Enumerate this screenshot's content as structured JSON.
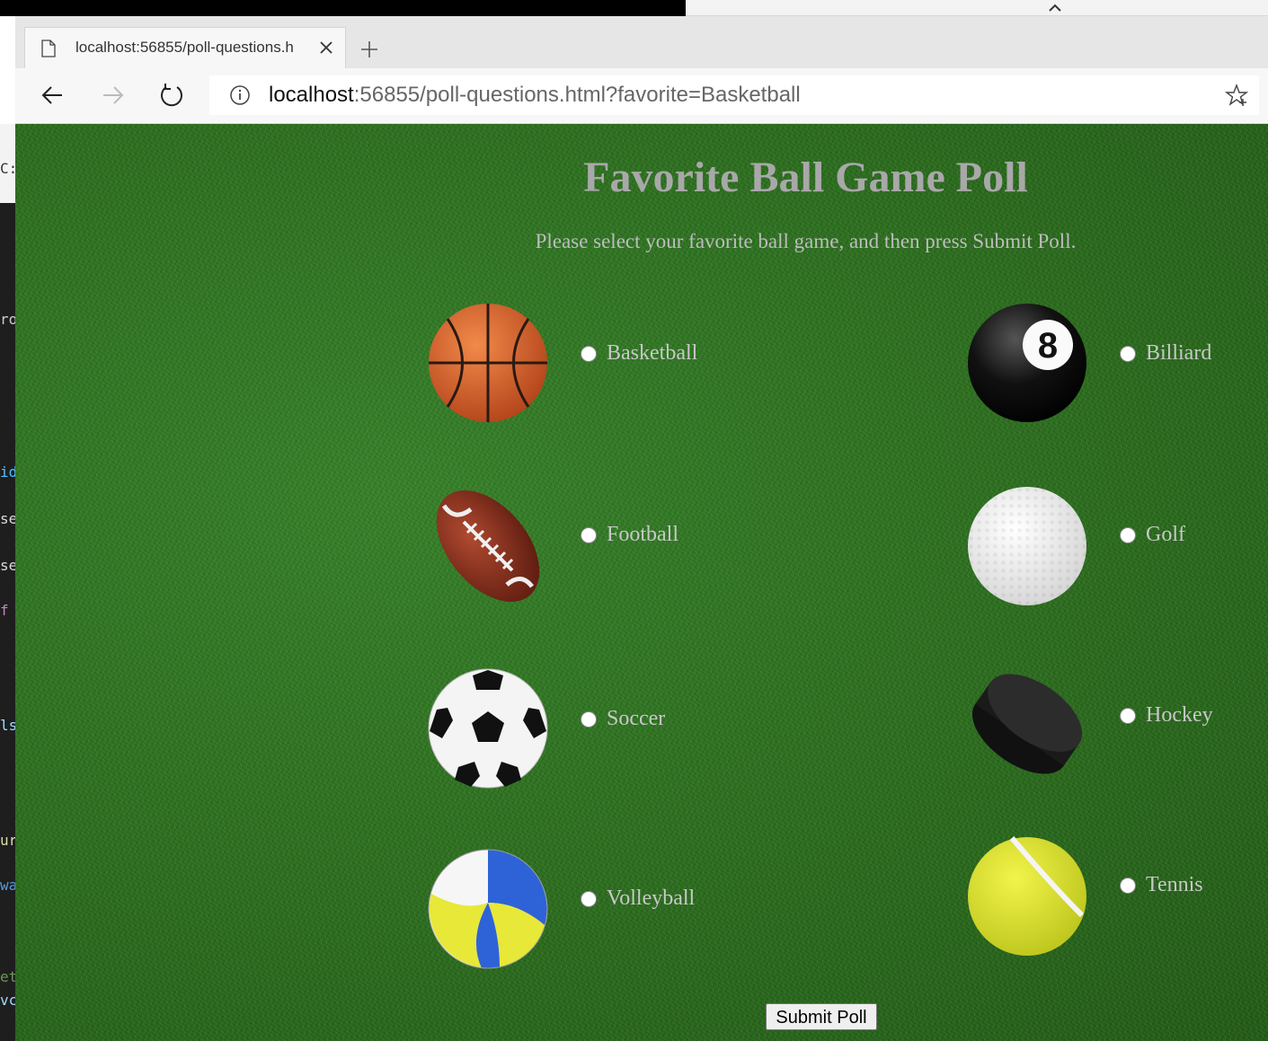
{
  "browser": {
    "tab_title": "localhost:56855/poll-questions.h",
    "url_host": "localhost",
    "url_rest": ":56855/poll-questions.html?favorite=Basketball"
  },
  "page": {
    "title": "Favorite Ball Game Poll",
    "subtitle": "Please select your favorite ball game, and then press Submit Poll.",
    "options_left": [
      {
        "label": "Basketball",
        "ball": "basketball-icon"
      },
      {
        "label": "Football",
        "ball": "football-icon"
      },
      {
        "label": "Soccer",
        "ball": "soccer-ball-icon"
      },
      {
        "label": "Volleyball",
        "ball": "volleyball-icon"
      }
    ],
    "options_right": [
      {
        "label": "Billiard",
        "ball": "billiard-ball-icon"
      },
      {
        "label": "Golf",
        "ball": "golf-ball-icon"
      },
      {
        "label": "Hockey",
        "ball": "hockey-puck-icon"
      },
      {
        "label": "Tennis",
        "ball": "tennis-ball-icon"
      }
    ],
    "submit_label": "Submit Poll"
  },
  "background_fragments": [
    "C:\\",
    "ro",
    "id",
    "se",
    "se",
    "f",
    "ls",
    "ur",
    "wa",
    "et",
    "vc"
  ],
  "colors": {
    "page_bg": "#2e6b1f",
    "title": "#a8a8a8",
    "text": "#c8c8c8"
  }
}
